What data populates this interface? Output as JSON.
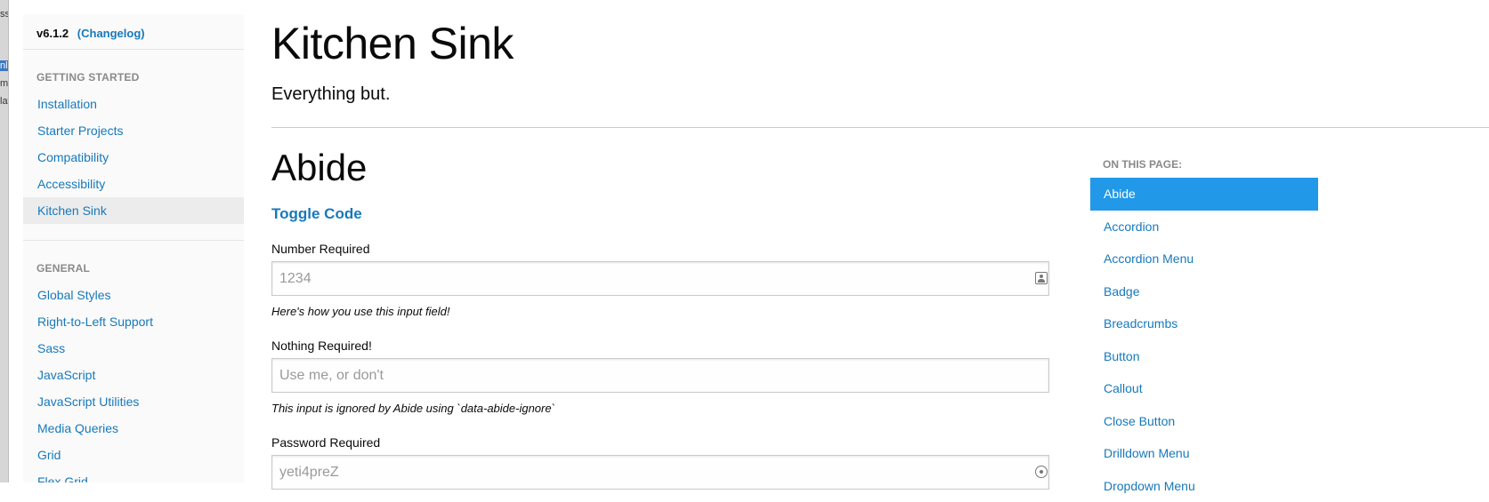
{
  "edge_fragments": [
    "ss",
    "nl",
    "mo",
    "lat"
  ],
  "sidebar": {
    "version": "v6.1.2",
    "changelog": "(Changelog)",
    "sections": [
      {
        "title": "GETTING STARTED",
        "items": [
          {
            "label": "Installation"
          },
          {
            "label": "Starter Projects"
          },
          {
            "label": "Compatibility"
          },
          {
            "label": "Accessibility"
          },
          {
            "label": "Kitchen Sink",
            "active": true
          }
        ]
      },
      {
        "title": "GENERAL",
        "items": [
          {
            "label": "Global Styles"
          },
          {
            "label": "Right-to-Left Support"
          },
          {
            "label": "Sass"
          },
          {
            "label": "JavaScript"
          },
          {
            "label": "JavaScript Utilities"
          },
          {
            "label": "Media Queries"
          },
          {
            "label": "Grid"
          },
          {
            "label": "Flex Grid"
          }
        ]
      }
    ]
  },
  "main": {
    "title": "Kitchen Sink",
    "lead": "Everything but.",
    "section_title": "Abide",
    "toggle_code": "Toggle Code",
    "fields": [
      {
        "label": "Number Required",
        "placeholder": "1234",
        "help": "Here's how you use this input field!",
        "icon": "contact-card-icon"
      },
      {
        "label": "Nothing Required!",
        "placeholder": "Use me, or don't",
        "help": "This input is ignored by Abide using `data-abide-ignore`",
        "icon": null
      },
      {
        "label": "Password Required",
        "placeholder": "yeti4preZ",
        "help": "",
        "icon": "key-icon"
      }
    ]
  },
  "toc": {
    "title": "ON THIS PAGE:",
    "items": [
      {
        "label": "Abide",
        "active": true
      },
      {
        "label": "Accordion"
      },
      {
        "label": "Accordion Menu"
      },
      {
        "label": "Badge"
      },
      {
        "label": "Breadcrumbs"
      },
      {
        "label": "Button"
      },
      {
        "label": "Callout"
      },
      {
        "label": "Close Button"
      },
      {
        "label": "Drilldown Menu"
      },
      {
        "label": "Dropdown Menu"
      }
    ]
  },
  "colors": {
    "link": "#1779ba",
    "active_bg": "#2199e8",
    "sidebar_bg": "#fafafa"
  }
}
